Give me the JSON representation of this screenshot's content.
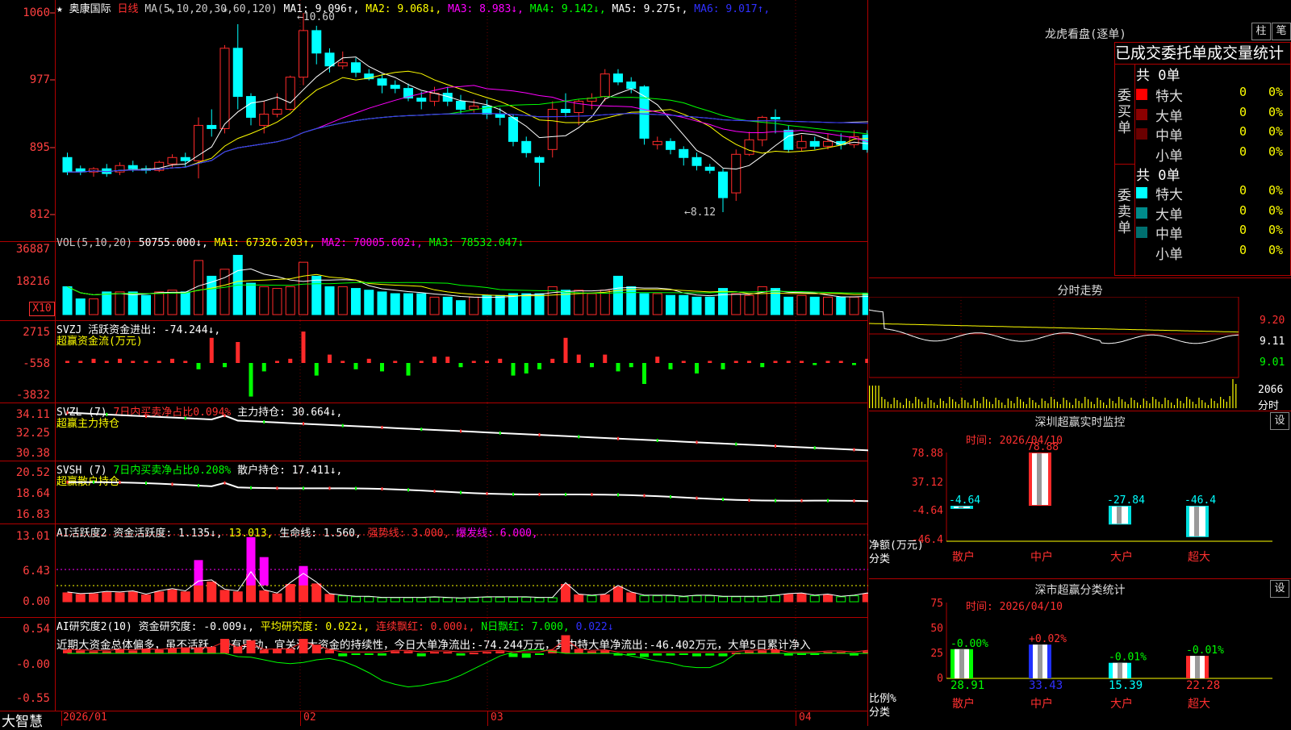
{
  "title": {
    "star": "★",
    "name": "奥康国际",
    "period": "日线",
    "ma_params": "MA(5,10,20,30,60,120)"
  },
  "colors": {
    "up": "#ff2a2a",
    "down": "#00ffff",
    "bg": "#000000",
    "grid": "#b00000",
    "ma1": "#ffffff",
    "ma2": "#ffff00",
    "ma3": "#ff00ff",
    "ma4": "#00ff00",
    "ma5": "#c0c0c0",
    "ma6": "#3030ff"
  },
  "ma_legend": [
    {
      "text": "MA1: 9.096↑",
      "color": "#ffffff"
    },
    {
      "text": "MA2: 9.068↓",
      "color": "#ffff00"
    },
    {
      "text": "MA3: 8.983↓",
      "color": "#ff00ff"
    },
    {
      "text": "MA4: 9.142↓",
      "color": "#00ff00"
    },
    {
      "text": "MA5: 9.275↑",
      "color": "#ffffff"
    },
    {
      "text": "MA6: 9.017↑",
      "color": "#3030ff"
    }
  ],
  "price_axis": [
    "1060",
    "977",
    "895",
    "812"
  ],
  "price_marks": {
    "high": "10.60",
    "low": "8.12"
  },
  "vol": {
    "label": "VOL(5,10,20)",
    "value": "50755.000↓,",
    "ma1": "MA1: 67326.203↑,",
    "ma2": "MA2: 70005.602↓,",
    "ma3": "MA3: 78532.047↓",
    "axis": [
      "36887",
      "18216"
    ],
    "unit": "X10"
  },
  "svzj": {
    "label": "SVZJ  活跃资金进出: -74.244↓,",
    "sub": "超赢资金流(万元)",
    "axis": [
      "2715",
      "-558",
      "-3832"
    ]
  },
  "svzl": {
    "label": "SVZL (7)",
    "ratio": "7日内买卖净占比0.094%",
    "hold": "主力持仓: 30.664↓,",
    "sub": "超赢主力持仓",
    "axis": [
      "34.11",
      "32.25",
      "30.38"
    ]
  },
  "svsh": {
    "label": "SVSH (7)",
    "ratio": "7日内买卖净占比0.208%",
    "hold": "散户持仓: 17.411↓,",
    "sub": "超赢散户持仓",
    "axis": [
      "20.52",
      "18.64",
      "16.83"
    ]
  },
  "ai1": {
    "label": "AI活跃度2",
    "a": "资金活跃度: 1.135↓,",
    "b": "13.013,",
    "c": "生命线: 1.560,",
    "d": "强势线: 3.000,",
    "e": "爆发线: 6.000,",
    "axis": [
      "13.01",
      "6.43",
      "0.00"
    ]
  },
  "ai2": {
    "label": "AI研究度2(10)",
    "a": "资金研究度: -0.009↓,",
    "b": "平均研究度: 0.022↓,",
    "c": "连续飘红: 0.000↓,",
    "d": "N日飘红: 7.000,",
    "e": "0.022↓",
    "note": "近期大资金总体偏多，虽不活跃，但有异动，宜关注大资金的持续性，今日大单净流出:-74.244万元，其中特大单净流出:-46.402万元，大单5日累计净入",
    "axis": [
      "0.54",
      "-0.00",
      "-0.55"
    ]
  },
  "x_axis": {
    "d1": "2026/01",
    "d2": "02",
    "d3": "03",
    "d4": "04"
  },
  "logo": "大智慧",
  "right": {
    "lhkp": "龙虎看盘(逐单)",
    "btn_zhu": "柱",
    "btn_bi": "笔",
    "stats_title": "已成交委托单成交量统计",
    "buy": {
      "label": "委买单",
      "total": "共 0单",
      "rows": [
        {
          "name": "特大",
          "v": "0",
          "p": "0%",
          "c": "#ff0000"
        },
        {
          "name": "大单",
          "v": "0",
          "p": "0%",
          "c": "#8b0000"
        },
        {
          "name": "中单",
          "v": "0",
          "p": "0%",
          "c": "#6b0000"
        },
        {
          "name": "小单",
          "v": "0",
          "p": "0%",
          "c": ""
        }
      ]
    },
    "sell": {
      "label": "委卖单",
      "total": "共 0单",
      "rows": [
        {
          "name": "特大",
          "v": "0",
          "p": "0%",
          "c": "#00ffff"
        },
        {
          "name": "大单",
          "v": "0",
          "p": "0%",
          "c": "#008b8b"
        },
        {
          "name": "中单",
          "v": "0",
          "p": "0%",
          "c": "#007070"
        },
        {
          "name": "小单",
          "v": "0",
          "p": "0%",
          "c": ""
        }
      ]
    },
    "fenshi": {
      "title": "分时走势",
      "p1": "9.20",
      "p2": "9.11",
      "p3": "9.01",
      "vol": "2066",
      "unit": "分时"
    },
    "sz_monitor": {
      "title": "深圳超赢实时监控",
      "set": "设",
      "time": "时间: 2026/04/10",
      "axis": [
        "78.88",
        "37.12",
        "-4.64",
        "-46.4"
      ],
      "ylabel": "净额(万元)",
      "xlabel": "分类",
      "bars": [
        {
          "cat": "散户",
          "val": "-4.64",
          "v": -4.64
        },
        {
          "cat": "中户",
          "val": "78.88",
          "v": 78.88
        },
        {
          "cat": "大户",
          "val": "-27.84",
          "v": -27.84
        },
        {
          "cat": "超大",
          "val": "-46.4",
          "v": -46.4
        }
      ]
    },
    "sz_class": {
      "title": "深市超赢分类统计",
      "set": "设",
      "time": "时间: 2026/04/10",
      "axis": [
        "75",
        "50",
        "25",
        "0"
      ],
      "ylabel": "比例%",
      "xlabel": "分类",
      "bars": [
        {
          "cat": "散户",
          "pct": "28.91",
          "chg": "-0.00%",
          "v": 28.91
        },
        {
          "cat": "中户",
          "pct": "33.43",
          "chg": "+0.02%",
          "v": 33.43
        },
        {
          "cat": "大户",
          "pct": "15.39",
          "chg": "-0.01%",
          "v": 15.39
        },
        {
          "cat": "超大",
          "pct": "22.28",
          "chg": "-0.01%",
          "v": 22.28
        }
      ]
    }
  }
}
